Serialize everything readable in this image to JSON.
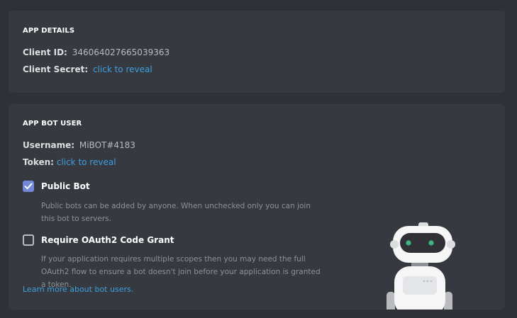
{
  "app_details": {
    "title": "APP DETAILS",
    "client_id_label": "Client ID:",
    "client_id_value": "346064027665039363",
    "client_secret_label": "Client Secret:",
    "client_secret_link": "click to reveal"
  },
  "bot_user": {
    "title": "APP BOT USER",
    "username_label": "Username:",
    "username_value": "MiBOT#4183",
    "token_label": "Token:",
    "token_link": "click to reveal",
    "public_bot": {
      "label": "Public Bot",
      "checked": true,
      "description": "Public bots can be added by anyone. When unchecked only you can join this bot to servers."
    },
    "oauth2_grant": {
      "label": "Require OAuth2 Code Grant",
      "checked": false,
      "description": "If your application requires multiple scopes then you may need the full OAuth2 flow to ensure a bot doesn't join before your application is granted a token."
    },
    "learn_more_link": "Learn more about bot users."
  },
  "colors": {
    "background": "#2f3136",
    "card": "#36393f",
    "link": "#3ea0e0",
    "checkbox_checked": "#7289da",
    "robot_eyes": "#43b581"
  },
  "icons": {
    "checkbox_checked": "check-icon",
    "illustration": "robot-illustration"
  }
}
